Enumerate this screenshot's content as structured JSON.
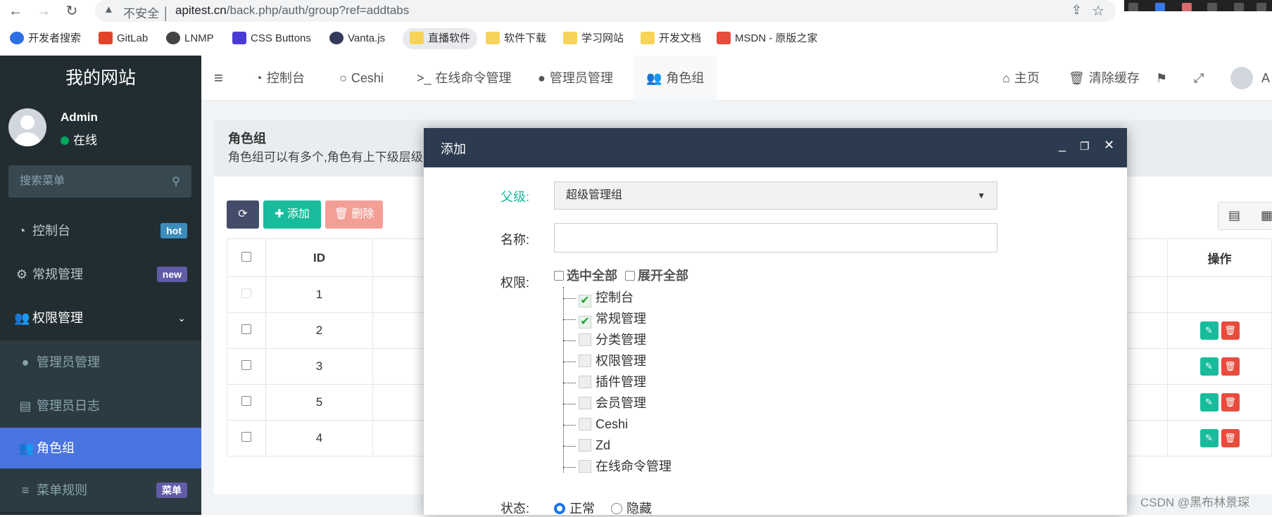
{
  "browser": {
    "insecure_label": "不安全",
    "url_main": "apitest.cn",
    "url_path": "/back.php/auth/group?ref=addtabs",
    "bookmarks": [
      "开发者搜索",
      "GitLab",
      "LNMP",
      "CSS Buttons",
      "Vanta.js",
      "直播软件",
      "软件下载",
      "学习网站",
      "开发文档",
      "MSDN - 原版之家"
    ]
  },
  "sidebar": {
    "site_title": "我的网站",
    "user_name": "Admin",
    "user_status": "在线",
    "search_placeholder": "搜索菜单",
    "items": [
      {
        "label": "控制台",
        "badge": "hot",
        "badge_color": "#3c8dbc"
      },
      {
        "label": "常规管理",
        "badge": "new",
        "badge_color": "#605ca8"
      },
      {
        "label": "权限管理"
      }
    ],
    "sub_items": [
      {
        "label": "管理员管理"
      },
      {
        "label": "管理员日志"
      },
      {
        "label": "角色组"
      },
      {
        "label": "菜单规则",
        "badge": "菜单",
        "badge_color": "#605ca8"
      }
    ]
  },
  "topnav": {
    "tabs": [
      "控制台",
      "Ceshi",
      "在线命令管理",
      "管理员管理",
      "角色组"
    ],
    "home": "主页",
    "clear_cache": "清除缓存",
    "user_short": "A"
  },
  "panel": {
    "title": "角色组",
    "desc": "角色组可以有多个,角色有上下级层级"
  },
  "toolbar": {
    "add_label": "添加",
    "delete_label": "删除"
  },
  "table": {
    "headers": {
      "id": "ID",
      "ops": "操作"
    },
    "rows": [
      "1",
      "2",
      "3",
      "5",
      "4"
    ]
  },
  "modal": {
    "title": "添加",
    "parent_label": "父级:",
    "parent_value": "超级管理组",
    "name_label": "名称:",
    "name_value": "",
    "perm_label": "权限:",
    "select_all": "选中全部",
    "expand_all": "展开全部",
    "tree": [
      {
        "label": "控制台",
        "checked": true
      },
      {
        "label": "常规管理",
        "checked": true
      },
      {
        "label": "分类管理",
        "checked": false
      },
      {
        "label": "权限管理",
        "checked": false
      },
      {
        "label": "插件管理",
        "checked": false
      },
      {
        "label": "会员管理",
        "checked": false
      },
      {
        "label": "Ceshi",
        "checked": false
      },
      {
        "label": "Zd",
        "checked": false
      },
      {
        "label": "在线命令管理",
        "checked": false
      }
    ],
    "status_label": "状态:",
    "status_normal": "正常",
    "status_hidden": "隐藏"
  },
  "watermark": "CSDN @黑布林景琛",
  "colors": {
    "accent": "#18bc9c",
    "sidebar": "#222d32",
    "active": "#4a74e0",
    "modal_head": "#2c3b50"
  }
}
